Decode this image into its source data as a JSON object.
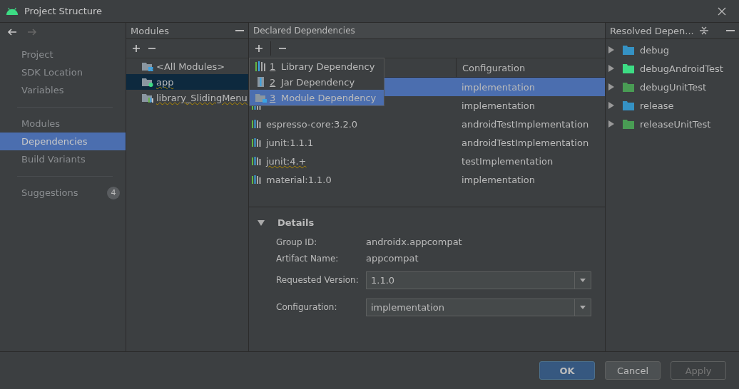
{
  "window": {
    "title": "Project Structure"
  },
  "sidebar": {
    "sections": [
      {
        "items": [
          {
            "label": "Project",
            "selected": false
          },
          {
            "label": "SDK Location",
            "selected": false
          },
          {
            "label": "Variables",
            "selected": false
          }
        ]
      },
      {
        "items": [
          {
            "label": "Modules",
            "selected": false
          },
          {
            "label": "Dependencies",
            "selected": true
          },
          {
            "label": "Build Variants",
            "selected": false
          }
        ]
      },
      {
        "items": [
          {
            "label": "Suggestions",
            "selected": false,
            "badge": "4"
          }
        ]
      }
    ]
  },
  "modules": {
    "title": "Modules",
    "items": [
      {
        "label": "<All Modules>",
        "kind": "all",
        "selected": false,
        "warning": false
      },
      {
        "label": "app",
        "kind": "app",
        "selected": true,
        "warning": true
      },
      {
        "label": "library_SlidingMenu",
        "kind": "library",
        "selected": false,
        "warning": true
      }
    ]
  },
  "declared": {
    "title": "Declared Dependencies",
    "columns": [
      "Configuration"
    ],
    "rows": [
      {
        "configuration": "implementation",
        "selected": true
      },
      {
        "kind": "library",
        "configuration": "implementation",
        "selected": false
      },
      {
        "kind": "library",
        "name": "espresso-core:3.2.0",
        "configuration": "androidTestImplementation",
        "selected": false,
        "warning": false
      },
      {
        "kind": "library",
        "name": "junit:1.1.1",
        "configuration": "androidTestImplementation",
        "selected": false,
        "warning": false
      },
      {
        "kind": "library",
        "name": "junit:4.+",
        "configuration": "testImplementation",
        "selected": false,
        "warning": true
      },
      {
        "kind": "library",
        "name": "material:1.1.0",
        "configuration": "implementation",
        "selected": false,
        "warning": false
      }
    ],
    "add_menu": [
      {
        "number": "1",
        "label": "Library Dependency",
        "kind": "library",
        "selected": false
      },
      {
        "number": "2",
        "label": "Jar Dependency",
        "kind": "jar",
        "selected": false
      },
      {
        "number": "3",
        "label": "Module Dependency",
        "kind": "module",
        "selected": true
      }
    ]
  },
  "details": {
    "title": "Details",
    "expanded": true,
    "fields": [
      {
        "label": "Group ID:",
        "value": "androidx.appcompat",
        "kind": "text"
      },
      {
        "label": "Artifact Name:",
        "value": "appcompat",
        "kind": "text"
      },
      {
        "label": "Requested Version:",
        "value": "1.1.0",
        "kind": "combo"
      },
      {
        "label": "Configuration:",
        "value": "implementation",
        "kind": "combo"
      }
    ]
  },
  "resolved": {
    "title": "Resolved Depen...",
    "items": [
      {
        "label": "debug",
        "color": "#3592c4"
      },
      {
        "label": "debugAndroidTest",
        "color": "#3ddc84"
      },
      {
        "label": "debugUnitTest",
        "color": "#499c54"
      },
      {
        "label": "release",
        "color": "#3592c4"
      },
      {
        "label": "releaseUnitTest",
        "color": "#499c54"
      }
    ]
  },
  "buttons": [
    {
      "label": "OK",
      "kind": "primary",
      "disabled": false
    },
    {
      "label": "Cancel",
      "kind": "normal",
      "disabled": false
    },
    {
      "label": "Apply",
      "kind": "normal",
      "disabled": true
    }
  ]
}
